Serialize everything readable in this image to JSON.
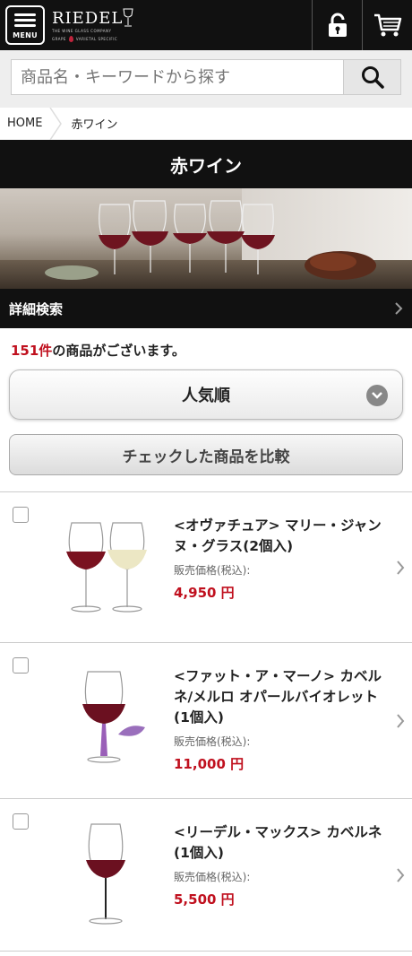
{
  "header": {
    "menu_label": "MENU",
    "brand": "RIEDEL",
    "brand_sub1": "THE WINE GLASS COMPANY",
    "brand_sub2_left": "GRAPE",
    "brand_sub2_right": "VARIETAL SPECIFIC"
  },
  "search": {
    "placeholder": "商品名・キーワードから探す"
  },
  "breadcrumb": {
    "home": "HOME",
    "current": "赤ワイン"
  },
  "page_title": "赤ワイン",
  "detail_search_label": "詳細検索",
  "result_count": {
    "number": "151件",
    "suffix": "の商品がございます。"
  },
  "sort": {
    "selected": "人気順"
  },
  "compare_label": "チェックした商品を比較",
  "products": [
    {
      "name": "<オヴァチュア> マリー・ジャンヌ・グラス(2個入)",
      "price_label": "販売価格(税込):",
      "price": "4,950 円"
    },
    {
      "name": "<ファット・ア・マーノ> カベルネ/メルロ オパールバイオレット(1個入)",
      "price_label": "販売価格(税込):",
      "price": "11,000 円"
    },
    {
      "name": "<リーデル・マックス> カベルネ(1個入)",
      "price_label": "販売価格(税込):",
      "price": "5,500 円"
    }
  ],
  "colors": {
    "accent_red": "#c0101e",
    "header_bg": "#111111"
  }
}
